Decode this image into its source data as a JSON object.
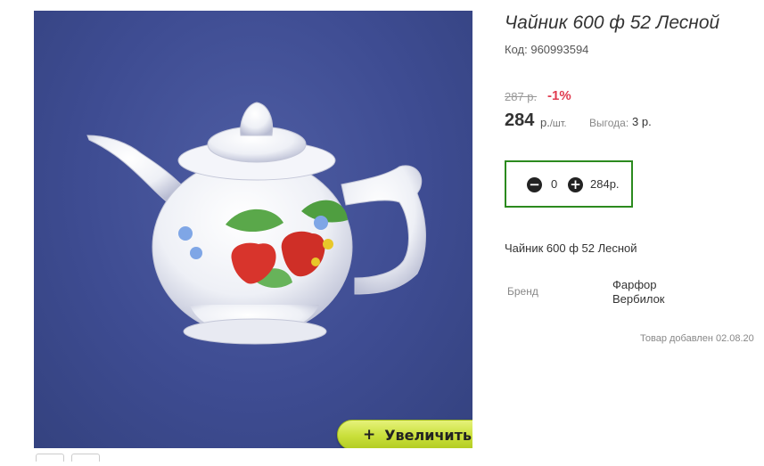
{
  "product": {
    "title": "Чайник 600 ф 52 Лесной",
    "code_label": "Код:",
    "code": "960993594",
    "old_price": "287 р.",
    "discount": "-1%",
    "price": "284",
    "price_currency": "р.",
    "price_unit": "/шт.",
    "benefit_label": "Выгода:",
    "benefit_value": "3 р.",
    "description": "Чайник 600 ф 52 Лесной",
    "brand_label": "Бренд",
    "brand_value": "Фарфор Вербилок",
    "added_text": "Товар добавлен 02.08.20"
  },
  "quantity": {
    "value": "0",
    "total": "284р."
  },
  "gallery": {
    "zoom_label": "Увеличить",
    "zoom_icon": "plus-icon",
    "background_color": "#3e4c92"
  },
  "colors": {
    "discount": "#e03c50",
    "qty_border": "#2b8a1e",
    "zoom_button": "#c9df3a"
  }
}
